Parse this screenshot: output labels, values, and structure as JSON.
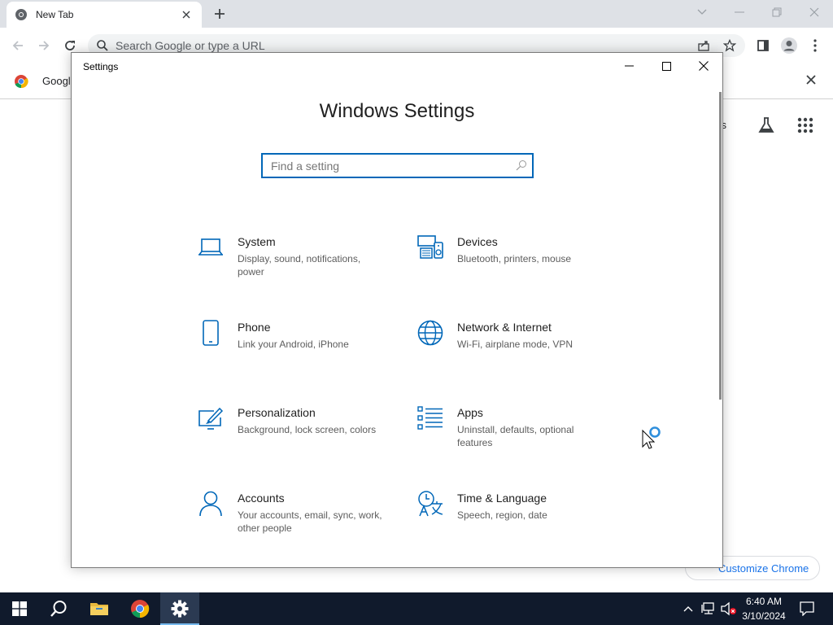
{
  "browser": {
    "tab_title": "New Tab",
    "omnibox_placeholder": "Search Google or type a URL",
    "infobar_text": "Googl",
    "ntp_link_partial": "ges",
    "customize_label": "Customize Chrome"
  },
  "settings": {
    "window_title": "Settings",
    "heading": "Windows Settings",
    "search_placeholder": "Find a setting",
    "tiles": [
      {
        "name": "System",
        "desc": "Display, sound, notifications, power",
        "icon": "laptop-icon"
      },
      {
        "name": "Devices",
        "desc": "Bluetooth, printers, mouse",
        "icon": "devices-icon"
      },
      {
        "name": "Phone",
        "desc": "Link your Android, iPhone",
        "icon": "phone-icon"
      },
      {
        "name": "Network & Internet",
        "desc": "Wi-Fi, airplane mode, VPN",
        "icon": "globe-icon"
      },
      {
        "name": "Personalization",
        "desc": "Background, lock screen, colors",
        "icon": "paint-icon"
      },
      {
        "name": "Apps",
        "desc": "Uninstall, defaults, optional features",
        "icon": "apps-list-icon"
      },
      {
        "name": "Accounts",
        "desc": "Your accounts, email, sync, work, other people",
        "icon": "person-icon"
      },
      {
        "name": "Time & Language",
        "desc": "Speech, region, date",
        "icon": "time-language-icon"
      }
    ]
  },
  "taskbar": {
    "time": "6:40 AM",
    "date": "3/10/2024"
  },
  "colors": {
    "accent": "#0067b8",
    "taskbar": "#101a2c",
    "chrome_tabstrip": "#dee1e6"
  }
}
